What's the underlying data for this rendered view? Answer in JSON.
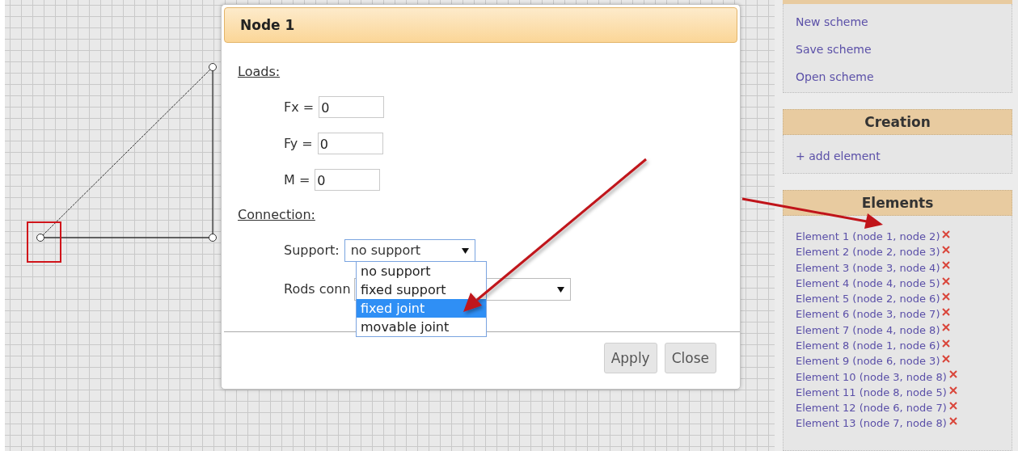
{
  "scheme_menu": [
    {
      "label": "New scheme"
    },
    {
      "label": "Save scheme"
    },
    {
      "label": "Open scheme"
    }
  ],
  "creation": {
    "title": "Creation",
    "links": [
      "+ add element"
    ]
  },
  "elements_panel": {
    "title": "Elements",
    "items": [
      {
        "label": "Element 1 (node 1, node 2)"
      },
      {
        "label": "Element 2 (node 2, node 3)"
      },
      {
        "label": "Element 3 (node 3, node 4)"
      },
      {
        "label": "Element 4 (node 4, node 5)"
      },
      {
        "label": "Element 5 (node 2, node 6)"
      },
      {
        "label": "Element 6 (node 3, node 7)"
      },
      {
        "label": "Element 7 (node 4, node 8)"
      },
      {
        "label": "Element 8 (node 1, node 6)"
      },
      {
        "label": "Element 9 (node 6, node 3)"
      },
      {
        "label": "Element 10 (node 3, node 8)"
      },
      {
        "label": "Element 11 (node 8, node 5)"
      },
      {
        "label": "Element 12 (node 6, node 7)"
      },
      {
        "label": "Element 13 (node 7, node 8)"
      }
    ]
  },
  "dialog": {
    "title": "Node 1",
    "loads_heading": "Loads:",
    "loads": [
      {
        "label": "Fx =",
        "value": "0"
      },
      {
        "label": "Fy =",
        "value": "0"
      },
      {
        "label": "M =",
        "value": "0"
      }
    ],
    "connection_heading": "Connection:",
    "support": {
      "label": "Support:",
      "value": "no support",
      "expanded": true,
      "options": [
        {
          "label": "no support",
          "highlighted": false
        },
        {
          "label": "fixed support",
          "highlighted": false
        },
        {
          "label": "fixed joint",
          "highlighted": true
        },
        {
          "label": "movable joint",
          "highlighted": false
        }
      ]
    },
    "rods_connection": {
      "label": "Rods conn"
    },
    "buttons": [
      "Apply",
      "Close"
    ]
  }
}
